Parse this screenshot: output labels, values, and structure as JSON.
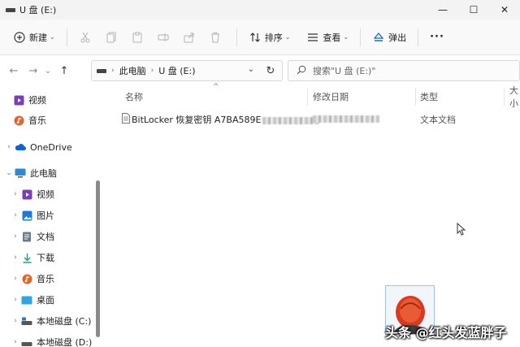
{
  "window": {
    "title": "U 盘 (E:)",
    "controls": {
      "minimize": "—",
      "maximize": "☐",
      "close": "✕"
    }
  },
  "toolbar": {
    "new_label": "新建",
    "sort_label": "排序",
    "view_label": "查看",
    "eject_label": "弹出",
    "more_label": "···"
  },
  "nav": {
    "back": "←",
    "forward": "→",
    "history": "⌄",
    "up": "↑"
  },
  "address": {
    "segments": [
      "此电脑",
      "U 盘 (E:)"
    ],
    "separator": "›"
  },
  "search": {
    "placeholder": "搜索\"U 盘 (E:)\""
  },
  "sidebar": {
    "items": [
      {
        "label": "视频",
        "icon": "video-icon"
      },
      {
        "label": "音乐",
        "icon": "music-icon"
      },
      {
        "label": "OneDrive",
        "icon": "cloud-icon"
      },
      {
        "label": "此电脑",
        "icon": "pc-icon"
      },
      {
        "label": "视频",
        "icon": "video-icon"
      },
      {
        "label": "图片",
        "icon": "pictures-icon"
      },
      {
        "label": "文档",
        "icon": "documents-icon"
      },
      {
        "label": "下载",
        "icon": "download-icon"
      },
      {
        "label": "音乐",
        "icon": "music-icon"
      },
      {
        "label": "桌面",
        "icon": "desktop-icon"
      },
      {
        "label": "本地磁盘 (C:)",
        "icon": "drive-icon"
      },
      {
        "label": "本地磁盘 (D:)",
        "icon": "drive-icon"
      }
    ]
  },
  "columns": {
    "name": "名称",
    "modified": "修改日期",
    "type": "类型",
    "size": "大小"
  },
  "files": [
    {
      "name": "BitLocker 恢复密钥 A7BA589E",
      "type": "文本文档"
    }
  ],
  "watermark": {
    "text": "头条 @红头发蓝胖子"
  },
  "colors": {
    "accent": "#0067c0",
    "video": "#7a3fb8",
    "music": "#e2652d",
    "onedrive": "#0a64d8"
  }
}
